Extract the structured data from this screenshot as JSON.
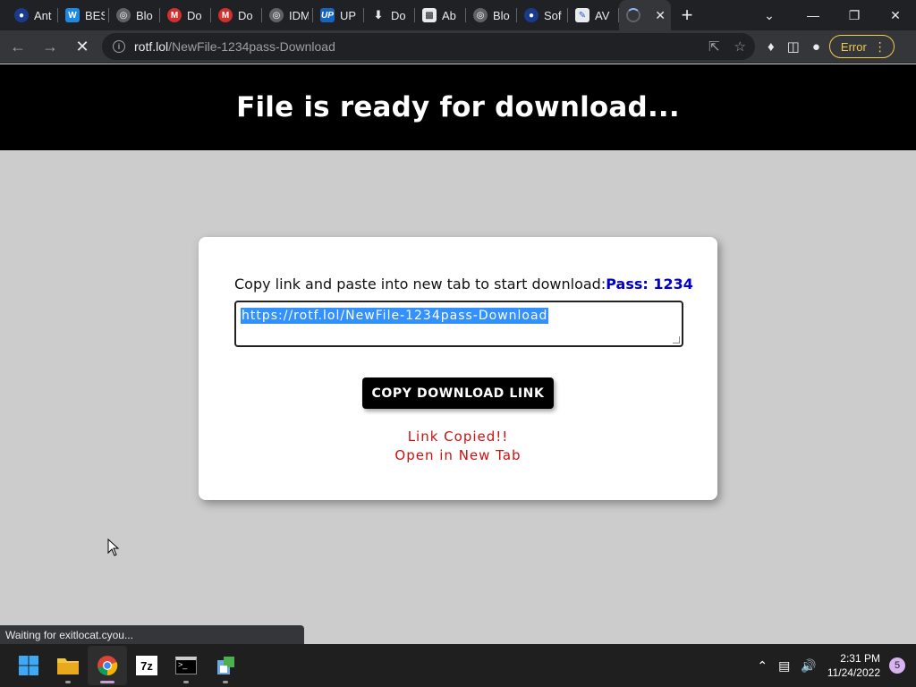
{
  "browser": {
    "tabs": [
      {
        "title": "Ant",
        "icon": "user-icon",
        "color": "#1a3a8a"
      },
      {
        "title": "BES",
        "icon": "w-icon",
        "color": "#1e88e5"
      },
      {
        "title": "Blo",
        "icon": "globe-icon",
        "color": "#5f6368"
      },
      {
        "title": "Do",
        "icon": "mega-icon",
        "color": "#d32f2f"
      },
      {
        "title": "Do",
        "icon": "mega-icon",
        "color": "#d32f2f"
      },
      {
        "title": "IDM",
        "icon": "globe-icon",
        "color": "#5f6368"
      },
      {
        "title": "UP",
        "icon": "up-icon",
        "color": "#1565c0"
      },
      {
        "title": "Do",
        "icon": "download-icon",
        "color": "#e8eaed"
      },
      {
        "title": "Ab",
        "icon": "film-icon",
        "color": "#e8eaed"
      },
      {
        "title": "Blo",
        "icon": "globe-icon",
        "color": "#5f6368"
      },
      {
        "title": "Sof",
        "icon": "user-icon",
        "color": "#1a3a8a"
      },
      {
        "title": "AV",
        "icon": "pencil-icon",
        "color": "#1565c0"
      }
    ],
    "url_host": "rotf.lol",
    "url_path": "/NewFile-1234pass-Download",
    "error_label": "Error",
    "status_text": "Waiting for exitlocat.cyou..."
  },
  "page": {
    "heading": "File is ready for download...",
    "instruction": "Copy link and paste into new tab to start download:",
    "pass_label": "Pass: 1234",
    "link_text": "https://rotf.lol/NewFile-1234pass-Download",
    "copy_button": "COPY DOWNLOAD LINK",
    "message_copied": "Link Copied!!",
    "message_open": "Open in New Tab"
  },
  "taskbar": {
    "time": "2:31 PM",
    "date": "11/24/2022",
    "notification_count": "5"
  }
}
